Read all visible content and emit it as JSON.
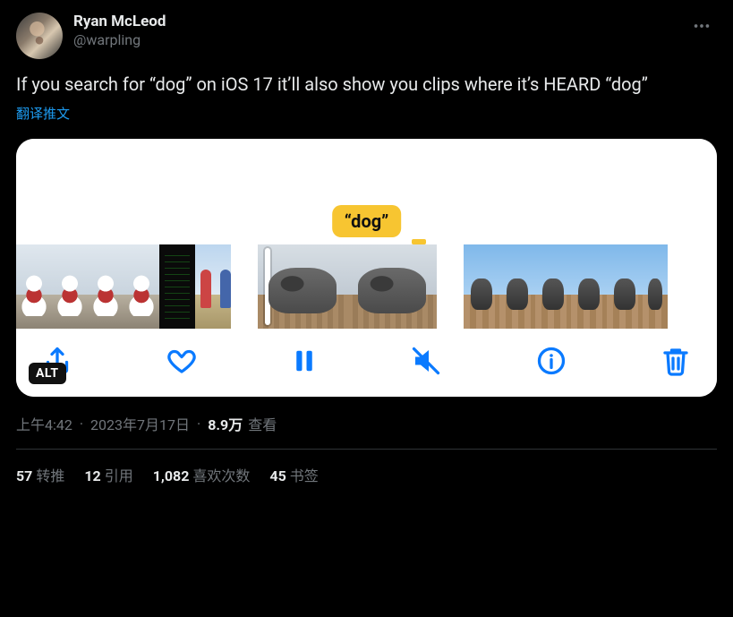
{
  "author": {
    "display_name": "Ryan McLeod",
    "handle": "@warpling"
  },
  "tweet_text": "If you search for “dog” on iOS 17 it’ll also show you clips where it’s HEARD “dog”",
  "translate_label": "翻译推文",
  "media": {
    "badge_text": "“dog”",
    "alt_label": "ALT"
  },
  "meta": {
    "time": "上午4:42",
    "date": "2023年7月17日",
    "views_number": "8.9万",
    "views_label": "查看"
  },
  "stats": {
    "retweets": {
      "count": "57",
      "label": "转推"
    },
    "quotes": {
      "count": "12",
      "label": "引用"
    },
    "likes": {
      "count": "1,082",
      "label": "喜欢次数"
    },
    "bookmarks": {
      "count": "45",
      "label": "书签"
    }
  }
}
